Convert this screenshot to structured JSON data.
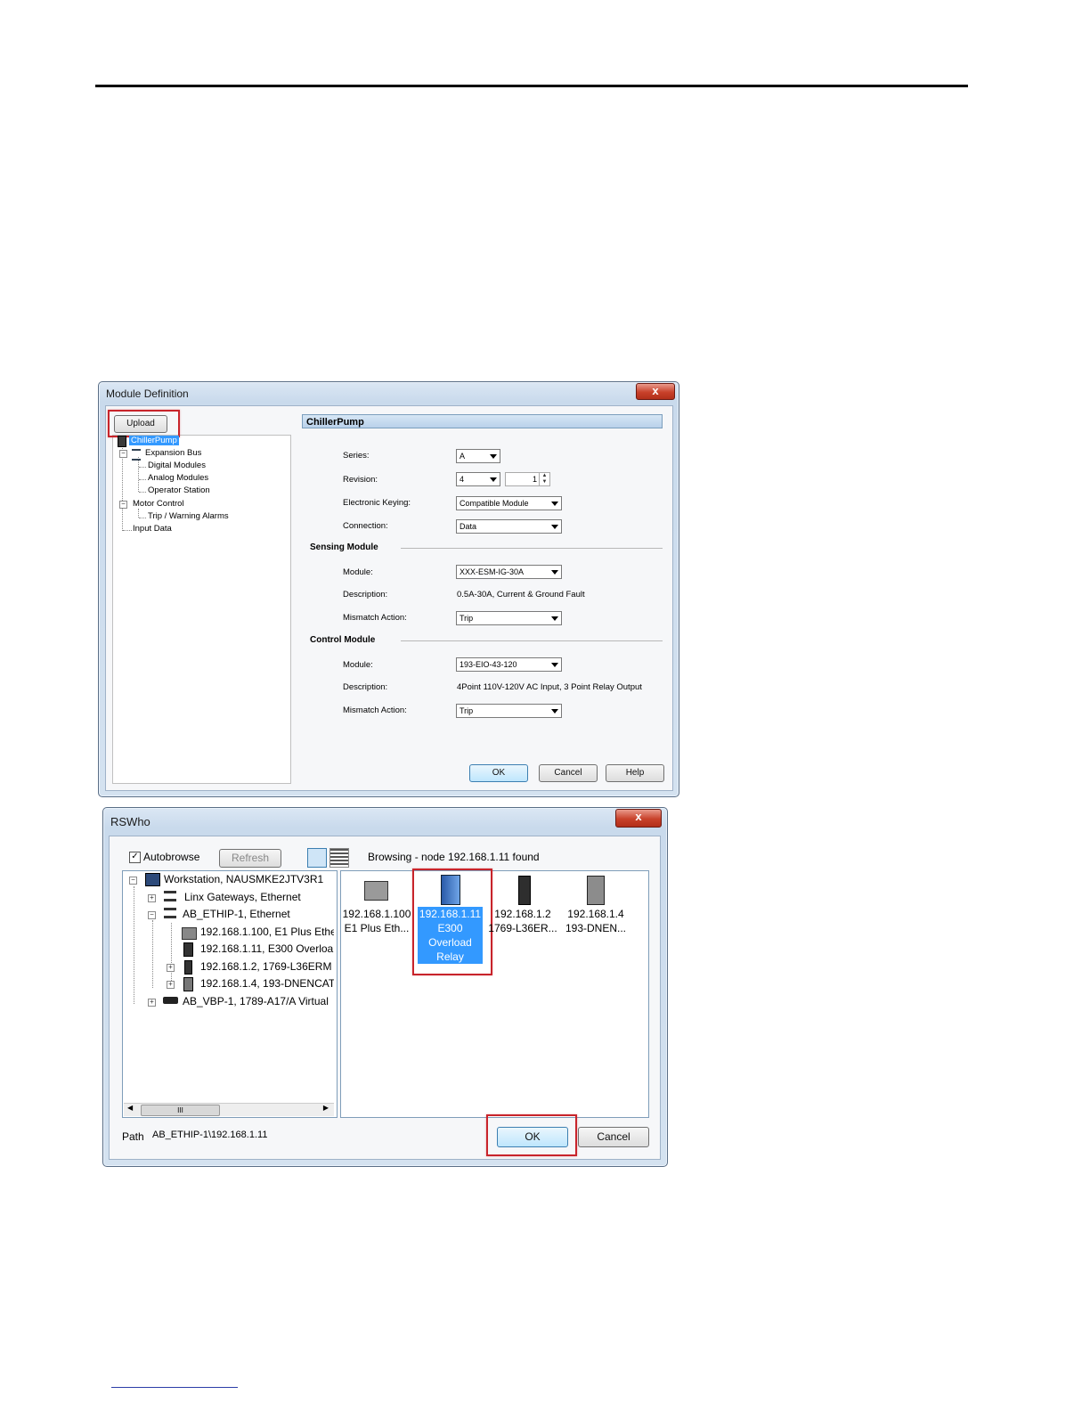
{
  "module_definition": {
    "title": "Module Definition",
    "close_label": "x",
    "upload_label": "Upload",
    "tree": {
      "root": "ChillerPump",
      "expansion_bus": "Expansion Bus",
      "digital_modules": "Digital Modules",
      "analog_modules": "Analog Modules",
      "operator_station": "Operator Station",
      "motor_control": "Motor Control",
      "trip_warning_alarms": "Trip / Warning Alarms",
      "input_data": "Input Data"
    },
    "header": "ChillerPump",
    "series_label": "Series:",
    "series_value": "A",
    "revision_label": "Revision:",
    "revision_major": "4",
    "revision_minor": "1",
    "keying_label": "Electronic Keying:",
    "keying_value": "Compatible Module",
    "connection_label": "Connection:",
    "connection_value": "Data",
    "sensing_section": "Sensing Module",
    "sensing_module_label": "Module:",
    "sensing_module_value": "XXX-ESM-IG-30A",
    "sensing_desc_label": "Description:",
    "sensing_desc_value": "0.5A-30A, Current & Ground Fault",
    "sensing_mismatch_label": "Mismatch Action:",
    "sensing_mismatch_value": "Trip",
    "control_section": "Control Module",
    "control_module_label": "Module:",
    "control_module_value": "193-EIO-43-120",
    "control_desc_label": "Description:",
    "control_desc_value": "4Point 110V-120V AC Input, 3 Point Relay Output",
    "control_mismatch_label": "Mismatch Action:",
    "control_mismatch_value": "Trip",
    "ok_label": "OK",
    "cancel_label": "Cancel",
    "help_label": "Help"
  },
  "rswho": {
    "title": "RSWho",
    "close_label": "x",
    "autobrowse_label": "Autobrowse",
    "autobrowse_checked": "✓",
    "refresh_label": "Refresh",
    "status": "Browsing - node 192.168.1.11 found",
    "tree": {
      "workstation": "Workstation, NAUSMKE2JTV3R1",
      "linx": "Linx Gateways, Ethernet",
      "ab_ethip": "AB_ETHIP-1, Ethernet",
      "n100": "192.168.1.100, E1 Plus Ethe",
      "n11": "192.168.1.11, E300 Overloa",
      "n2": "192.168.1.2, 1769-L36ERM",
      "n4": "192.168.1.4, 193-DNENCAT",
      "ab_vbp": "AB_VBP-1, 1789-A17/A Virtual"
    },
    "devices": [
      {
        "line1": "192.168.1.100",
        "line2": "E1 Plus Eth..."
      },
      {
        "line1": "192.168.1.11",
        "line2": "E300",
        "line3": "Overload",
        "line4": "Relay"
      },
      {
        "line1": "192.168.1.2",
        "line2": "1769-L36ER..."
      },
      {
        "line1": "192.168.1.4",
        "line2": "193-DNEN..."
      }
    ],
    "scroll_thumb": "III",
    "path_label": "Path",
    "path_value": "AB_ETHIP-1\\192.168.1.11",
    "ok_label": "OK",
    "cancel_label": "Cancel"
  },
  "colors": {
    "highlight_red": "#c8242b",
    "selection_blue": "#3399ff"
  }
}
